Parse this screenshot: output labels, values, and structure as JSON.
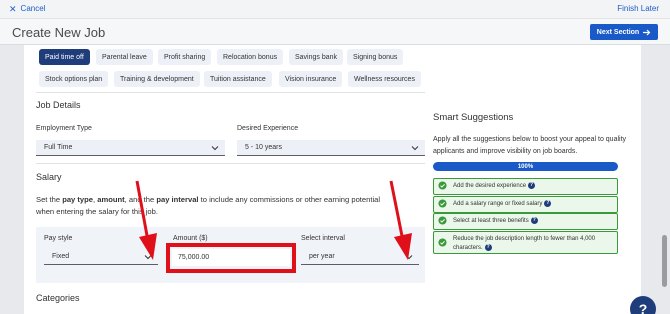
{
  "topbar": {
    "cancel_label": "Cancel",
    "finish_label": "Finish Later"
  },
  "header": {
    "title": "Create New Job",
    "next_label": "Next Section"
  },
  "benefits": [
    {
      "label": "Paid time off",
      "selected": true
    },
    {
      "label": "Parental leave",
      "selected": false
    },
    {
      "label": "Profit sharing",
      "selected": false
    },
    {
      "label": "Relocation bonus",
      "selected": false
    },
    {
      "label": "Savings bank",
      "selected": false
    },
    {
      "label": "Signing bonus",
      "selected": false
    },
    {
      "label": "Stock options plan",
      "selected": false
    },
    {
      "label": "Training & development",
      "selected": false
    },
    {
      "label": "Tuition assistance",
      "selected": false
    },
    {
      "label": "Vision insurance",
      "selected": false
    },
    {
      "label": "Wellness resources",
      "selected": false
    }
  ],
  "job_details": {
    "heading": "Job Details",
    "employment_type_label": "Employment Type",
    "employment_type_value": "Full Time",
    "experience_label": "Desired Experience",
    "experience_value": "5 - 10 years"
  },
  "salary": {
    "heading": "Salary",
    "desc_1": "Set the ",
    "desc_b1": "pay type",
    "desc_2": ", ",
    "desc_b2": "amount",
    "desc_3": ", and the ",
    "desc_b3": "pay interval",
    "desc_4": " to include any commissions or other earning potential when entering the salary for this job.",
    "pay_style_label": "Pay style",
    "pay_style_value": "Fixed",
    "amount_label": "Amount ($)",
    "amount_value": "75,000.00",
    "interval_label": "Select interval",
    "interval_value": "per year"
  },
  "categories": {
    "heading": "Categories"
  },
  "smart": {
    "title": "Smart Suggestions",
    "desc": "Apply all the suggestions below to boost your appeal to quality applicants and improve visibility on job boards.",
    "progress": 100,
    "progress_label": "100%",
    "suggestions": [
      "Add the desired experience",
      "Add a salary range or fixed salary",
      "Select at least three benefits",
      "Reduce the job description length to fewer than 4,000 characters."
    ]
  },
  "help": {
    "label": "?"
  },
  "colors": {
    "primary": "#1a5ac8",
    "navy": "#1f3d7a",
    "highlight": "#e0101a",
    "success": "#3a9a3a"
  }
}
